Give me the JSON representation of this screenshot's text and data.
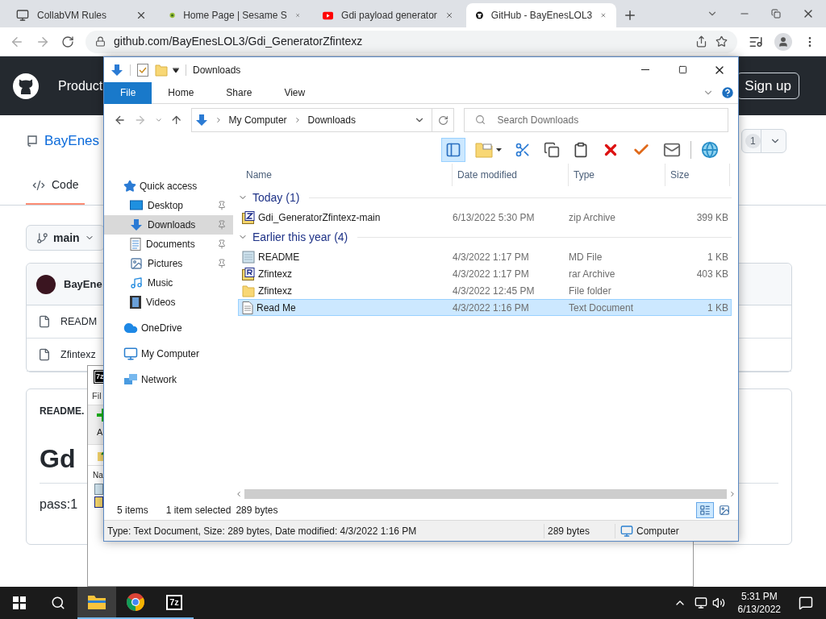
{
  "browser": {
    "tabs": [
      {
        "title": "CollabVM Rules",
        "kind": "monitor",
        "selected": false
      },
      {
        "title": "Home Page | Sesame S",
        "kind": "badge",
        "selected": false
      },
      {
        "title": "Gdi payload generator",
        "kind": "video",
        "selected": false
      },
      {
        "title": "GitHub - BayEnesLOL3",
        "kind": "github",
        "selected": true
      }
    ],
    "url": "github.com/BayEnesLOL3/Gdi_GeneratorZfintexz"
  },
  "github": {
    "nav_item": "Product",
    "sign_up": "Sign up",
    "repo_name": "BayEnes",
    "counter": "1",
    "tabs": [
      {
        "label": "Code",
        "selected": true
      }
    ],
    "branch": "main",
    "commit_author": "BayEne",
    "files": [
      "READM",
      "Zfintexz"
    ],
    "readme": {
      "title": "README.",
      "heading": "Gd",
      "text": "pass:1"
    }
  },
  "archiver": {
    "logo_text": "7z",
    "menu": "Fil",
    "toolbar_label": "A",
    "column": "Na"
  },
  "explorer": {
    "title": "Downloads",
    "ribbon_tabs": [
      {
        "label": "File",
        "selected": true
      },
      {
        "label": "Home",
        "selected": false
      },
      {
        "label": "Share",
        "selected": false
      },
      {
        "label": "View",
        "selected": false
      }
    ],
    "breadcrumb": [
      "My Computer",
      "Downloads"
    ],
    "search": {
      "placeholder": "Search Downloads"
    },
    "toolbar": [
      {
        "kind": "preview",
        "selected": true
      },
      {
        "kind": "new-folder",
        "selected": false
      },
      {
        "kind": "cut",
        "selected": false
      },
      {
        "kind": "copy",
        "selected": false
      },
      {
        "kind": "paste",
        "selected": false
      },
      {
        "kind": "delete",
        "selected": false
      },
      {
        "kind": "check",
        "selected": false
      },
      {
        "kind": "rename",
        "selected": false
      },
      {
        "kind": "globe",
        "selected": false
      }
    ],
    "nav": [
      {
        "label": "Quick access",
        "kind": "star",
        "selected": false,
        "children": [
          {
            "label": "Desktop",
            "kind": "desktop",
            "selected": false,
            "pinned": true
          },
          {
            "label": "Downloads",
            "kind": "download",
            "selected": true,
            "pinned": true
          },
          {
            "label": "Documents",
            "kind": "documents",
            "selected": false,
            "pinned": true
          },
          {
            "label": "Pictures",
            "kind": "pictures",
            "selected": false,
            "pinned": true
          },
          {
            "label": "Music",
            "kind": "music",
            "selected": false,
            "pinned": false
          },
          {
            "label": "Videos",
            "kind": "videos",
            "selected": false,
            "pinned": false
          }
        ]
      },
      {
        "label": "OneDrive",
        "kind": "cloud",
        "selected": false
      },
      {
        "label": "My Computer",
        "kind": "computer",
        "selected": false
      },
      {
        "label": "Network",
        "kind": "network",
        "selected": false
      }
    ],
    "columns": [
      "Name",
      "Date modified",
      "Type",
      "Size"
    ],
    "groups": [
      {
        "label": "Today (1)",
        "expanded": true,
        "files": [
          {
            "name": "Gdi_GeneratorZfintexz-main",
            "date": "6/13/2022 5:30 PM",
            "type": "zip Archive",
            "size": "399 KB",
            "kind": "zip",
            "selected": false
          }
        ]
      },
      {
        "label": "Earlier this year (4)",
        "expanded": true,
        "files": [
          {
            "name": "README",
            "date": "4/3/2022 1:17 PM",
            "type": "MD File",
            "size": "1 KB",
            "kind": "notes",
            "selected": false
          },
          {
            "name": "Zfintexz",
            "date": "4/3/2022 1:17 PM",
            "type": "rar Archive",
            "size": "403 KB",
            "kind": "rar",
            "selected": false
          },
          {
            "name": "Zfintexz",
            "date": "4/3/2022 12:45 PM",
            "type": "File folder",
            "kind": "folder",
            "selected": false
          },
          {
            "name": "Read Me",
            "date": "4/3/2022 1:16 PM",
            "type": "Text Document",
            "size": "1 KB",
            "kind": "text",
            "selected": true
          }
        ]
      }
    ],
    "status": {
      "items": "5 items",
      "selected": "1 item selected",
      "size": "289 bytes"
    },
    "views": [
      {
        "kind": "details",
        "selected": true
      },
      {
        "kind": "tiles",
        "selected": false
      }
    ],
    "details": {
      "text": "Type: Text Document, Size: 289 bytes, Date modified: 4/3/2022 1:16 PM",
      "size": "289 bytes",
      "location": "Computer"
    }
  },
  "taskbar": {
    "apps": [
      {
        "kind": "explorer",
        "selected": true
      },
      {
        "kind": "chrome",
        "selected": false
      },
      {
        "kind": "archiver",
        "selected": false,
        "logo_text": "7z"
      }
    ],
    "time": "5:31 PM",
    "date": "6/13/2022"
  }
}
